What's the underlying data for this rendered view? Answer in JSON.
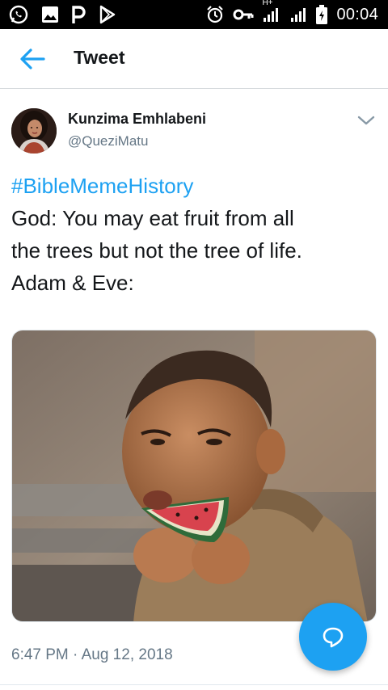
{
  "status_bar": {
    "time": "00:04",
    "network_label": "H+",
    "left_icons": [
      "whatsapp-icon",
      "gallery-icon",
      "p-app-icon",
      "play-store-icon"
    ],
    "right_icons": [
      "alarm-icon",
      "vpn-key-icon",
      "signal-icon",
      "signal-icon",
      "battery-icon"
    ]
  },
  "app_bar": {
    "title": "Tweet",
    "back_icon": "arrow-left-icon",
    "accent": "#1da1f2"
  },
  "tweet": {
    "author_name": "Kunzima Emhlabeni",
    "author_handle": "@QueziMatu",
    "hashtag": "#BibleMemeHistory",
    "lines": [
      "God: You may eat fruit from all",
      "the trees but not the tree of life.",
      "Adam & Eve:"
    ],
    "timestamp": "6:47 PM · Aug 12, 2018",
    "media": "photo of a small child biting into a slice of watermelon",
    "menu_icon": "chevron-down-icon"
  },
  "fab": {
    "icon": "reply-bubble-icon",
    "color": "#1da1f2"
  },
  "colors": {
    "text_primary": "#14171a",
    "text_secondary": "#657786",
    "link": "#1da1f2",
    "divider": "#e1e8ed"
  }
}
